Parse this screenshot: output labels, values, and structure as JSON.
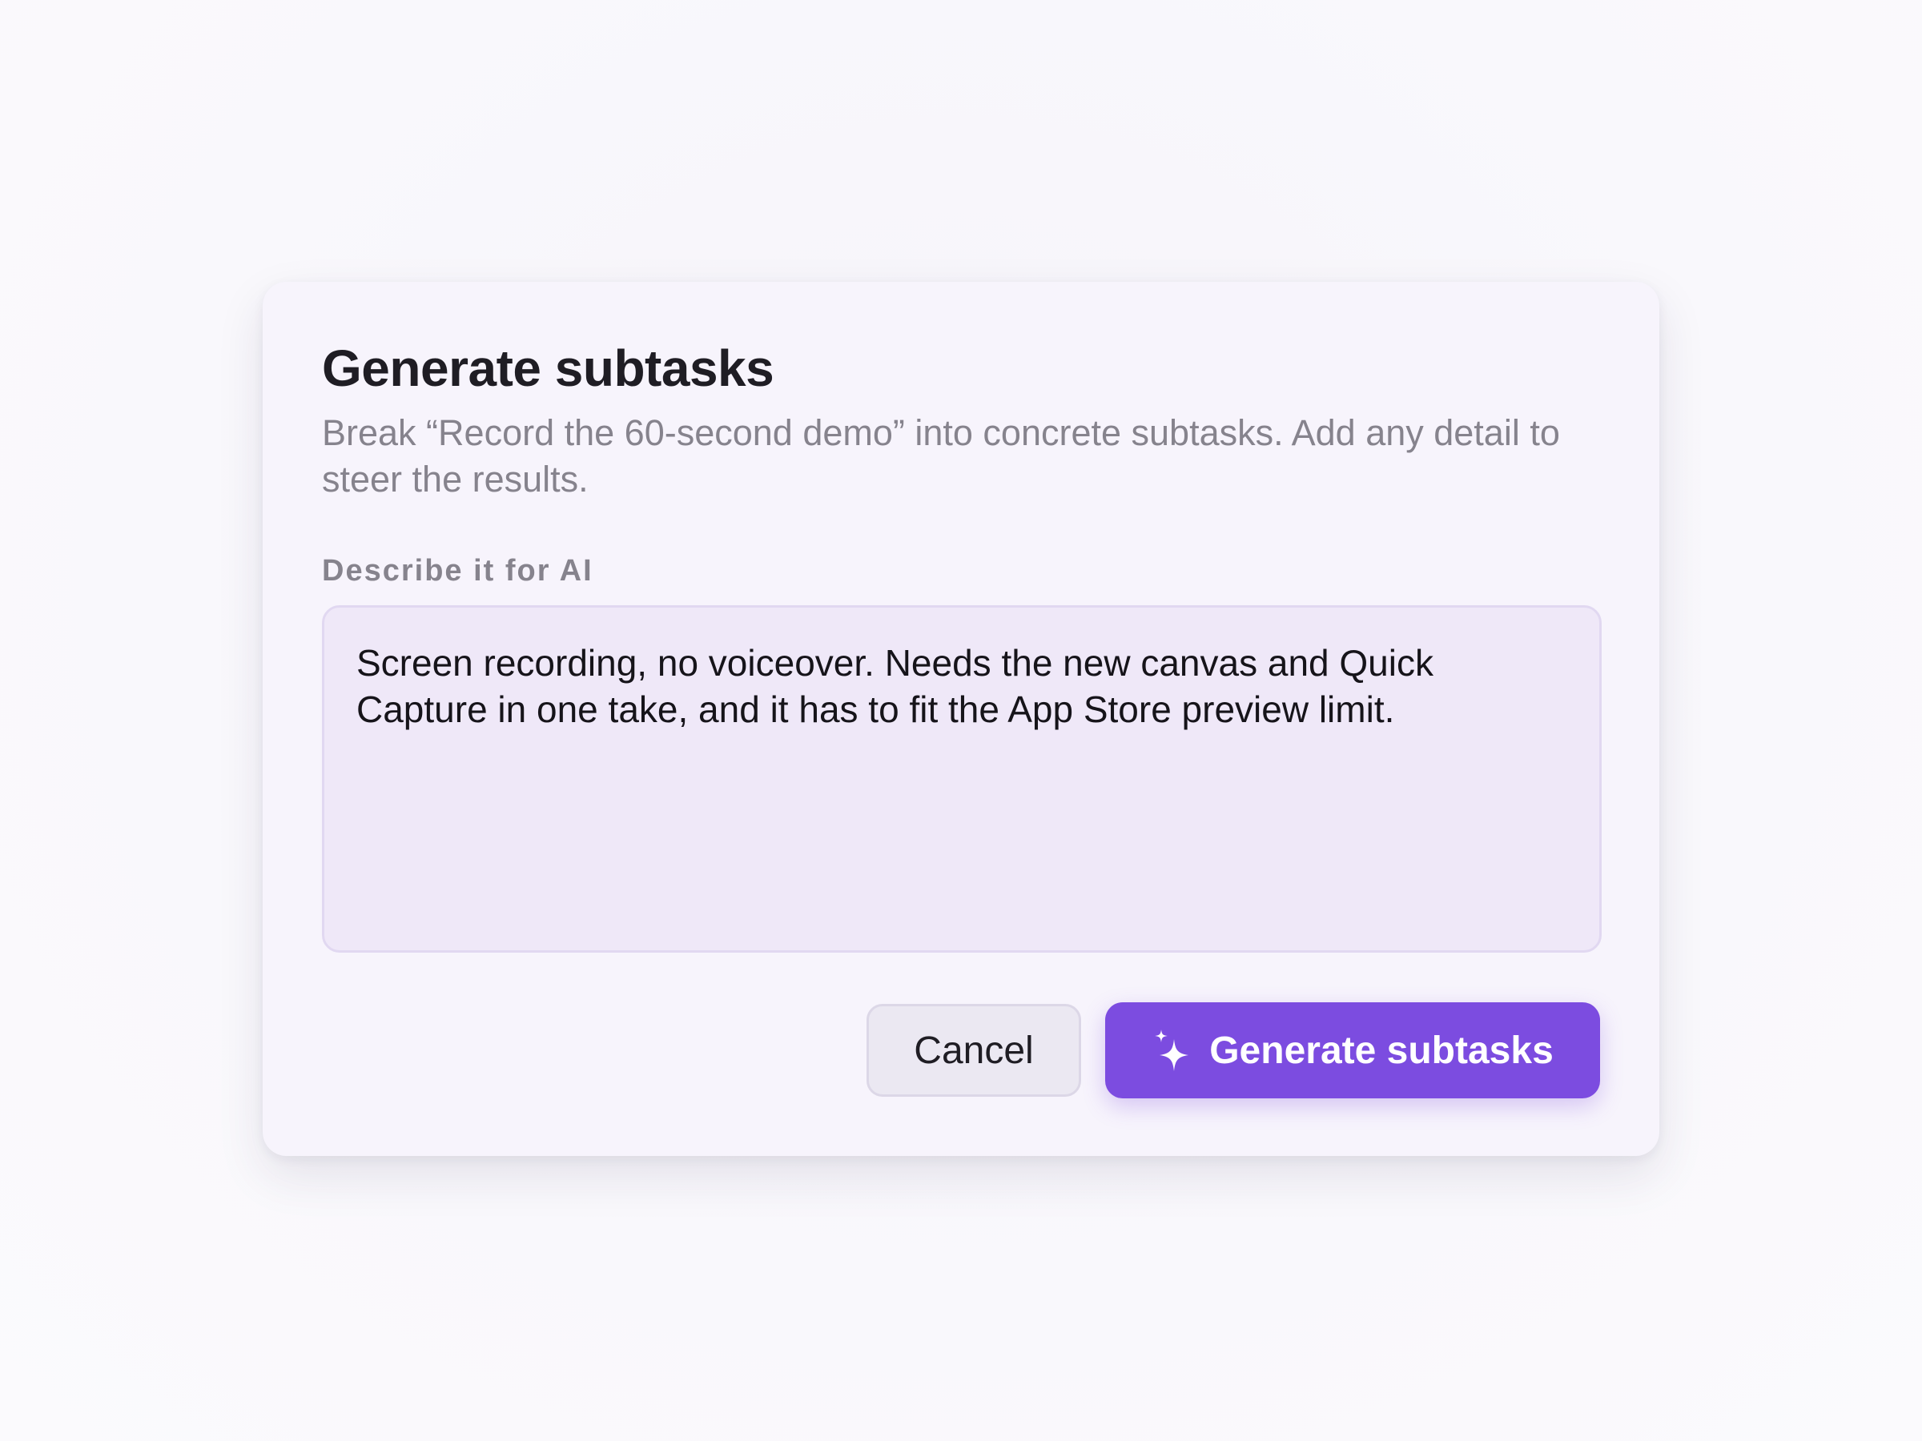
{
  "dialog": {
    "title": "Generate subtasks",
    "description": "Break “Record the 60-second demo” into concrete subtasks. Add any detail to steer the results.",
    "field_label": "Describe it for AI",
    "field_value": "Screen recording, no voiceover. Needs the new canvas and Quick Capture in one take, and it has to fit the App Store preview limit.",
    "cancel_label": "Cancel",
    "generate_label": "Generate subtasks",
    "generate_icon": "sparkle-icon"
  },
  "colors": {
    "accent": "#7c4ce0",
    "dialog_bg": "#f7f4fc",
    "field_bg": "#efe8f8"
  }
}
